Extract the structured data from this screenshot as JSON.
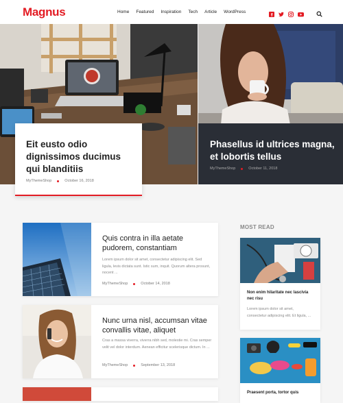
{
  "header": {
    "logo": "Magnus",
    "nav": [
      "Home",
      "Featured",
      "Inspiration",
      "Tech",
      "Article",
      "WordPress"
    ],
    "social_icons": [
      "facebook-icon",
      "twitter-icon",
      "instagram-icon",
      "youtube-icon"
    ],
    "accent_color": "#e31b23"
  },
  "hero": {
    "left": {
      "title": "Eit eusto odio dignissimos ducimus qui blanditiis",
      "author": "MyThemeShop",
      "date": "October 16, 2018"
    },
    "right": {
      "title": "Phasellus id ultrices magna, et lobortis tellus",
      "author": "MyThemeShop",
      "date": "October 11, 2018"
    }
  },
  "posts": [
    {
      "title": "Quis contra in illa aetate pudorem, constantiam",
      "excerpt": "Lorem ipsum dolor sit amet, consectetur adipiscing elit. Sed ligula, levis dictata sunt. Istic sum, inquit. Quorum altera prosunt, nocent ...",
      "author": "MyThemeShop",
      "date": "October 14, 2018"
    },
    {
      "title": "Nunc urna nisl, accumsan vitae convallis vitae, aliquet",
      "excerpt": "Cras a massa viverra, viverra nibh sed, molestie mi. Cras semper velit vel dolor interdum. Aenean efficitur scelerisque dictum. In ...",
      "author": "MyThemeShop",
      "date": "September 13, 2018"
    }
  ],
  "sidebar": {
    "heading": "MOST READ",
    "items": [
      {
        "title": "Non enim hilaritate nec lascivia nec risu",
        "excerpt": "Lorem ipsum dolor sit amet, consectetur adipiscing elit. Et ligula, ..."
      },
      {
        "title": "Praesent porta, tortor quis"
      }
    ]
  }
}
